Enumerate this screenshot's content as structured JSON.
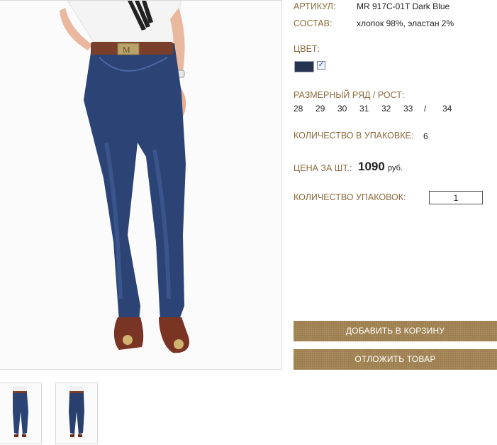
{
  "product": {
    "article_label": "АРТИКУЛ:",
    "article_value": "MR 917C-01T Dark Blue",
    "composition_label": "СОСТАВ:",
    "composition_value": "хлопок 98%, эластан 2%",
    "color_label": "ЦВЕТ:",
    "swatch_color": "#27344f",
    "swatch_checked_mark": "✓",
    "size_label": "РАЗМЕРНЫЙ РЯД / РОСТ:",
    "sizes": [
      "28",
      "29",
      "30",
      "31",
      "32",
      "33"
    ],
    "size_separator": "/",
    "height": "34",
    "pack_qty_label": "КОЛИЧЕСТВО В УПАКОВКЕ:",
    "pack_qty_value": "6",
    "price_label": "ЦЕНА ЗА ШТ.:",
    "price_value": "1090",
    "price_currency": "руб.",
    "packs_label": "КОЛИЧЕСТВО УПАКОВОК:",
    "packs_input_value": "1"
  },
  "actions": {
    "add_to_cart": "ДОБАВИТЬ В КОРЗИНУ",
    "save_item": "ОТЛОЖИТЬ ТОВАР"
  },
  "colors": {
    "label_brown": "#8b6b3d",
    "button_bg": "#9a7a47",
    "denim": "#27344f"
  }
}
